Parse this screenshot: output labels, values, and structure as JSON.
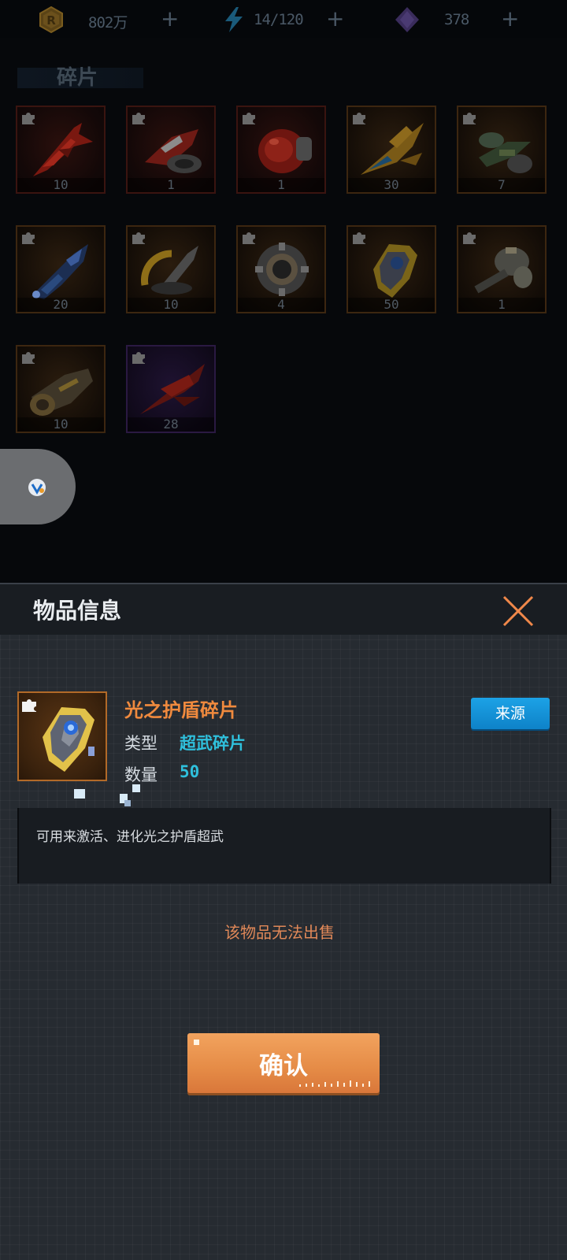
{
  "resources": {
    "gold": {
      "icon": "gold-coin-icon",
      "value": "802万",
      "add": "+"
    },
    "energy": {
      "icon": "lightning-icon",
      "value": "14/120",
      "add": "+"
    },
    "crystal": {
      "icon": "purple-crystal-icon",
      "value": "378",
      "add": "+"
    }
  },
  "section": {
    "title": "碎片"
  },
  "fragments": [
    {
      "icon": "red-fighter-icon",
      "count": "10",
      "frame": "red"
    },
    {
      "icon": "red-drone-icon",
      "count": "1",
      "frame": "red"
    },
    {
      "icon": "red-pod-icon",
      "count": "1",
      "frame": "red"
    },
    {
      "icon": "gold-blue-jet-icon",
      "count": "30",
      "frame": "orange"
    },
    {
      "icon": "green-gunship-icon",
      "count": "7",
      "frame": "orange"
    },
    {
      "icon": "blue-cruiser-icon",
      "count": "20",
      "frame": "orange"
    },
    {
      "icon": "gold-arc-cannon-icon",
      "count": "10",
      "frame": "orange"
    },
    {
      "icon": "grey-core-icon",
      "count": "4",
      "frame": "orange"
    },
    {
      "icon": "light-shield-icon",
      "count": "50",
      "frame": "orange"
    },
    {
      "icon": "gatling-turret-icon",
      "count": "1",
      "frame": "orange"
    },
    {
      "icon": "gold-engine-icon",
      "count": "10",
      "frame": "orange"
    },
    {
      "icon": "red-wing-fighter-icon",
      "count": "28",
      "frame": "purple"
    }
  ],
  "panel": {
    "title": "物品信息",
    "item_name": "光之护盾碎片",
    "type_label": "类型",
    "type_value": "超武碎片",
    "qty_label": "数量",
    "qty_value": "50",
    "source_button": "来源",
    "description": "可用来激活、进化光之护盾超武",
    "sell_note": "该物品无法出售",
    "confirm_button": "确认"
  },
  "colors": {
    "item_name": "#f08a3e",
    "type_value": "#2fc0dc",
    "source_button": "#1a9be0",
    "confirm_button": "#e58b46",
    "sell_note": "#e08858"
  }
}
